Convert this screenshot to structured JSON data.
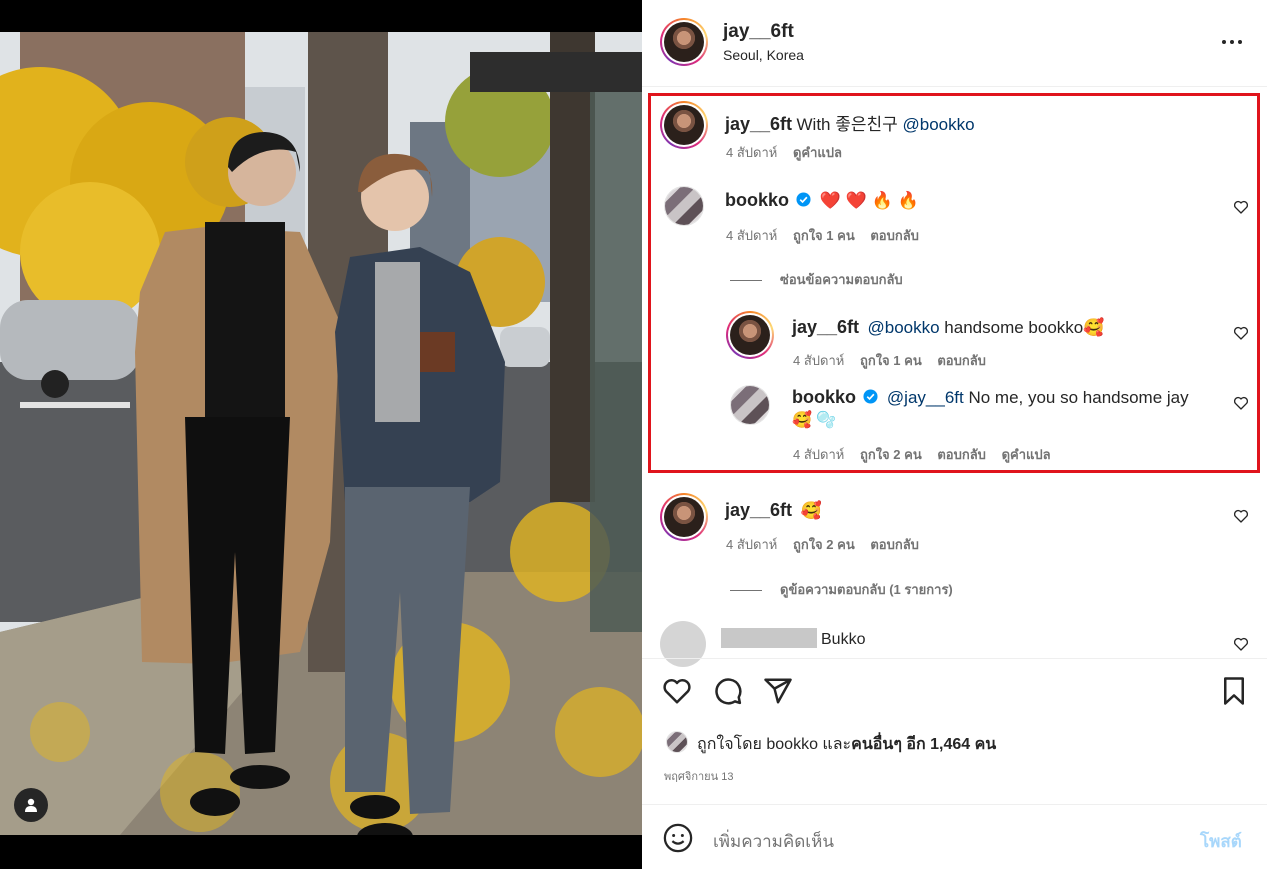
{
  "post_header": {
    "username": "jay__6ft",
    "location": "Seoul, Korea"
  },
  "caption": {
    "username": "jay__6ft",
    "text_prefix": "With 좋은친구 ",
    "mention": "@bookko",
    "time": "4 สัปดาห์",
    "translate": "ดูคำแปล"
  },
  "comments": [
    {
      "username": "bookko",
      "verified": true,
      "text": "❤️ ❤️ 🔥 🔥",
      "time": "4 สัปดาห์",
      "likes": "ถูกใจ 1 คน",
      "reply": "ตอบกลับ",
      "toggle_replies": "ซ่อนข้อความตอบกลับ",
      "replies": [
        {
          "username": "jay__6ft",
          "mention": "@bookko",
          "text": " handsome bookko🥰",
          "time": "4 สัปดาห์",
          "likes": "ถูกใจ 1 คน",
          "reply": "ตอบกลับ"
        },
        {
          "username": "bookko",
          "verified": true,
          "mention": "@jay__6ft",
          "text": " No me, you so handsome jay",
          "text_line2": "🥰 🫧",
          "time": "4 สัปดาห์",
          "likes": "ถูกใจ 2 คน",
          "reply": "ตอบกลับ",
          "translate": "ดูคำแปล"
        }
      ]
    },
    {
      "username": "jay__6ft",
      "text": "🥰",
      "time": "4 สัปดาห์",
      "likes": "ถูกใจ 2 คน",
      "reply": "ตอบกลับ",
      "toggle_replies": "ดูข้อความตอบกลับ (1 รายการ)"
    },
    {
      "username_redacted": true,
      "text": "Bukko"
    }
  ],
  "likes_summary": {
    "prefix": "ถูกใจโดย ",
    "user": "bookko",
    "middle": " และ",
    "others": "คนอื่นๆ อีก 1,464 คน"
  },
  "post_date": "พฤศจิกายน 13",
  "comment_box": {
    "placeholder": "เพิ่มความคิดเห็น",
    "post_label": "โพสต์"
  },
  "icons": {
    "more": "more-options-icon",
    "like": "heart-icon",
    "comment": "comment-icon",
    "share": "share-icon",
    "save": "bookmark-icon",
    "emoji": "emoji-icon",
    "user_tag": "user-tag-icon"
  },
  "colors": {
    "mention": "#00376b",
    "verified": "#0095f6",
    "post_button": "#a8d7fb",
    "highlight": "#e0141c"
  }
}
